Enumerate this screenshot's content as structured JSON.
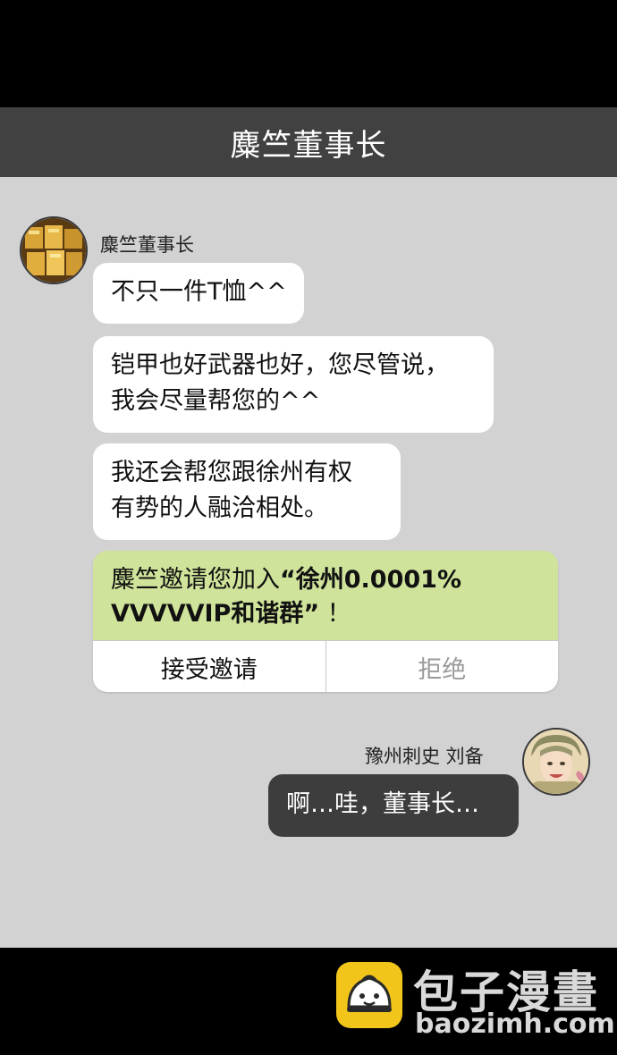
{
  "header": {
    "title": "麋竺董事长"
  },
  "incoming": {
    "sender_name": "麋竺董事长",
    "messages": [
      {
        "lines": [
          "不只一件T恤^^"
        ]
      },
      {
        "lines": [
          "铠甲也好武器也好，您尽管说，",
          "我会尽量帮您的^^"
        ]
      },
      {
        "lines": [
          "我还会帮您跟徐州有权",
          "有势的人融洽相处。"
        ]
      }
    ],
    "invite": {
      "text_prefix": "麋竺邀请您加入",
      "open_quote": "“",
      "group_name_line1": "徐州0.0001%",
      "group_name_line2": "VVVVVIP和谐群",
      "close_quote": "”",
      "text_suffix": "！",
      "accept_label": "接受邀请",
      "reject_label": "拒绝"
    }
  },
  "outgoing": {
    "sender_name": "豫州刺史 刘备",
    "message": "啊…哇，董事长…"
  },
  "footer": {
    "logo_text": "包子漫畫",
    "logo_url": "baozimh.com"
  },
  "colors": {
    "header_bg": "#414141",
    "chat_bg": "#d2d2d2",
    "invite_bg": "#cfe39a",
    "outgoing_bubble": "#3d3d3d",
    "logo_yellow": "#f2c51b"
  }
}
